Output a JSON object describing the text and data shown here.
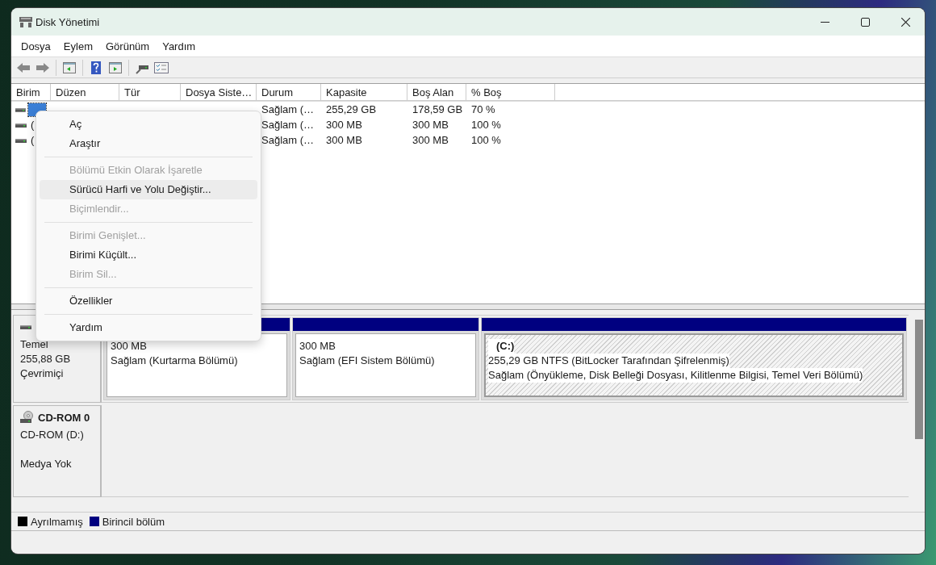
{
  "window": {
    "title": "Disk Yönetimi"
  },
  "menu_bar": [
    "Dosya",
    "Eylem",
    "Görünüm",
    "Yardım"
  ],
  "volume_table": {
    "columns": [
      "Birim",
      "Düzen",
      "Tür",
      "Dosya Siste…",
      "Durum",
      "Kapasite",
      "Boş Alan",
      "% Boş"
    ],
    "rows": [
      {
        "selected": true,
        "cells": [
          null,
          null,
          null,
          null,
          "Sağlam (…",
          "255,29 GB",
          "178,59 GB",
          "70 %"
        ]
      },
      {
        "selected": false,
        "cells": [
          "(",
          null,
          null,
          null,
          "Sağlam (…",
          "300 MB",
          "300 MB",
          "100 %"
        ]
      },
      {
        "selected": false,
        "cells": [
          "(",
          null,
          null,
          null,
          "Sağlam (…",
          "300 MB",
          "300 MB",
          "100 %"
        ]
      }
    ]
  },
  "disks": [
    {
      "kind": "disk",
      "lines": [
        "Temel",
        "255,88 GB",
        "Çevrimiçi"
      ],
      "partitions": [
        {
          "selected": false,
          "lines": [
            "300 MB",
            "Sağlam (Kurtarma Bölümü)"
          ]
        },
        {
          "selected": false,
          "lines": [
            "300 MB",
            "Sağlam (EFI Sistem Bölümü)"
          ]
        },
        {
          "selected": true,
          "title": "(C:)",
          "lines": [
            "255,29 GB NTFS (BitLocker Tarafından Şifrelenmiş)",
            "Sağlam (Önyükleme, Disk Belleği Dosyası, Kilitlenme Bilgisi, Temel Veri Bölümü)"
          ]
        }
      ]
    },
    {
      "kind": "cdrom",
      "name": "CD-ROM 0",
      "lines": [
        "CD-ROM (D:)"
      ],
      "media": "Medya Yok"
    }
  ],
  "legend": [
    {
      "label": "Ayrılmamış",
      "color": "#000000"
    },
    {
      "label": "Birincil bölüm",
      "color": "#000080"
    }
  ],
  "context_menu": [
    {
      "kind": "item",
      "label": "Aç",
      "disabled": false,
      "highlighted": false
    },
    {
      "kind": "item",
      "label": "Araştır",
      "disabled": false,
      "highlighted": false
    },
    {
      "kind": "separator"
    },
    {
      "kind": "item",
      "label": "Bölümü Etkin Olarak İşaretle",
      "disabled": true,
      "highlighted": false
    },
    {
      "kind": "item",
      "label": "Sürücü Harfi ve Yolu Değiştir...",
      "disabled": false,
      "highlighted": true
    },
    {
      "kind": "item",
      "label": "Biçimlendir...",
      "disabled": true,
      "highlighted": false
    },
    {
      "kind": "separator"
    },
    {
      "kind": "item",
      "label": "Birimi Genişlet...",
      "disabled": true,
      "highlighted": false
    },
    {
      "kind": "item",
      "label": "Birimi Küçült...",
      "disabled": false,
      "highlighted": false
    },
    {
      "kind": "item",
      "label": "Birim Sil...",
      "disabled": true,
      "highlighted": false
    },
    {
      "kind": "separator"
    },
    {
      "kind": "item",
      "label": "Özellikler",
      "disabled": false,
      "highlighted": false
    },
    {
      "kind": "separator"
    },
    {
      "kind": "item",
      "label": "Yardım",
      "disabled": false,
      "highlighted": false
    }
  ]
}
